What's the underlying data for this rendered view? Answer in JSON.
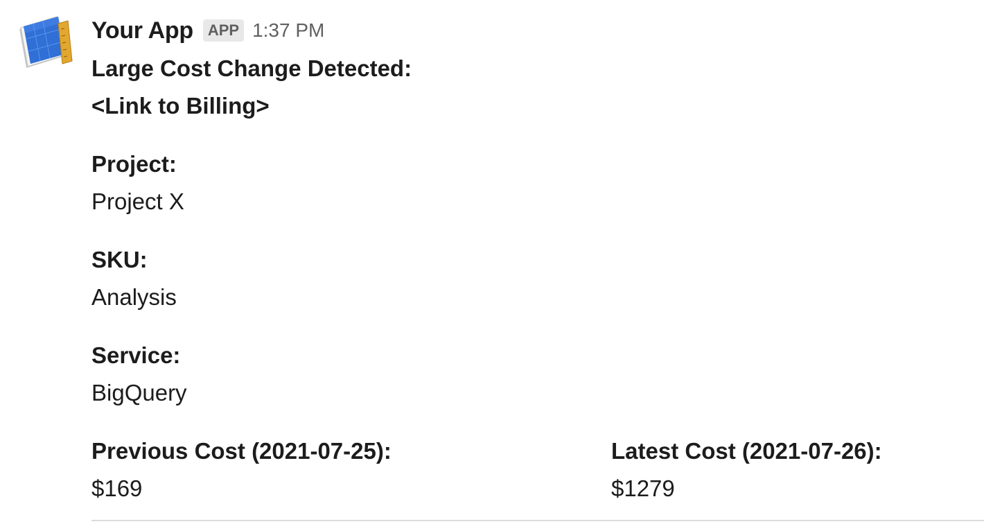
{
  "message": {
    "app_name": "Your App",
    "badge": "APP",
    "timestamp": "1:37 PM",
    "title": "Large Cost Change Detected:",
    "link_text": "<Link to Billing>",
    "fields": [
      {
        "label": "Project:",
        "value": "Project X"
      },
      {
        "label": "SKU:",
        "value": "Analysis"
      },
      {
        "label": "Service:",
        "value": "BigQuery"
      }
    ],
    "cost_fields": {
      "previous": {
        "label": "Previous Cost (2021-07-25):",
        "value": "$169"
      },
      "latest": {
        "label": "Latest Cost (2021-07-26):",
        "value": "$1279"
      }
    }
  },
  "colors": {
    "text": "#1d1c1d",
    "muted": "#616061",
    "badge_bg": "#e8e8e8",
    "avatar_book": "#2f6fd6",
    "avatar_ruler": "#e2a72e"
  },
  "icons": {
    "avatar": "blueprint-book-with-ruler-icon"
  }
}
